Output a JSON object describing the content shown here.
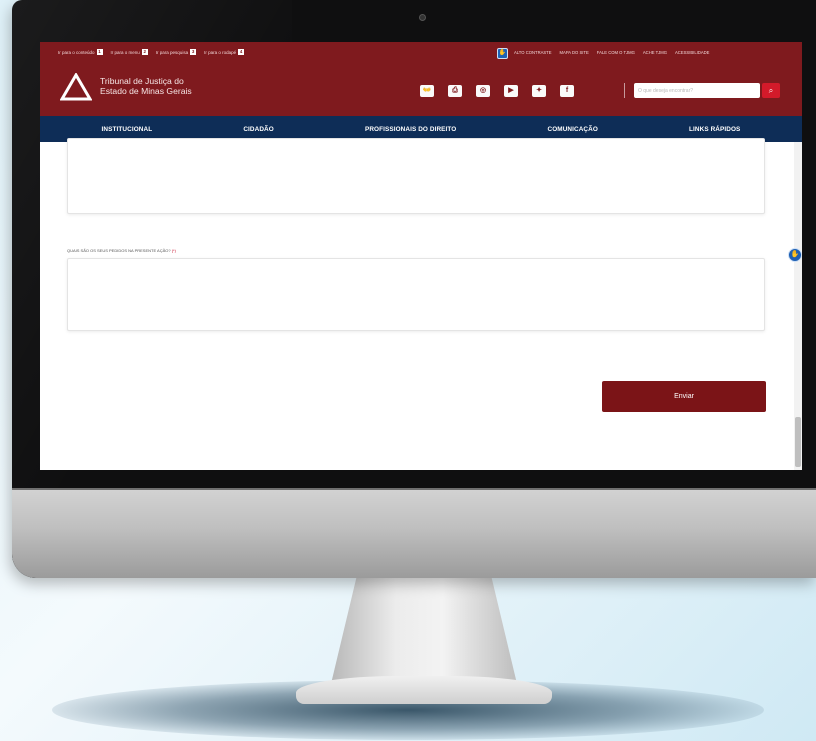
{
  "accessibility_bar": {
    "links": [
      {
        "label": "Ir para o conteúdo",
        "key": "1"
      },
      {
        "label": "Ir para o menu",
        "key": "2"
      },
      {
        "label": "Ir para pesquisa",
        "key": "3"
      },
      {
        "label": "Ir para o rodapé",
        "key": "4"
      }
    ],
    "util_links": [
      "Alto contraste",
      "Mapa do site",
      "Fale com o TJMG",
      "Ache TJMG",
      "Acessibilidade"
    ],
    "vlibras_icon": "hand-sign-icon"
  },
  "header": {
    "logo_icon": "triangle-logo-icon",
    "logo_line1": "Tribunal de Justiça do",
    "logo_line2": "Estado de Minas Gerais",
    "social": [
      {
        "icon": "libras-icon",
        "glyph": "👐"
      },
      {
        "icon": "printer-icon",
        "glyph": "⎙"
      },
      {
        "icon": "instagram-icon",
        "glyph": "◎"
      },
      {
        "icon": "youtube-icon",
        "glyph": "▶"
      },
      {
        "icon": "twitter-icon",
        "glyph": "✦"
      },
      {
        "icon": "facebook-icon",
        "glyph": "f"
      }
    ],
    "search_placeholder": "O que deseja encontrar?",
    "search_icon_glyph": "⌕"
  },
  "nav": {
    "items": [
      "INSTITUCIONAL",
      "CIDADÃO",
      "PROFISSIONAIS DO DIREITO",
      "COMUNICAÇÃO",
      "LINKS RÁPIDOS"
    ]
  },
  "form": {
    "pedidos_label": "QUAIS SÃO OS SEUS PEDIDOS NA PRESENTE AÇÃO?",
    "required_mark": "(*)",
    "submit_label": "Enviar"
  },
  "colors": {
    "brand_red": "#7f1a1e",
    "nav_blue": "#0e2d57",
    "button_red": "#7b1417",
    "search_red": "#d31a2a"
  }
}
